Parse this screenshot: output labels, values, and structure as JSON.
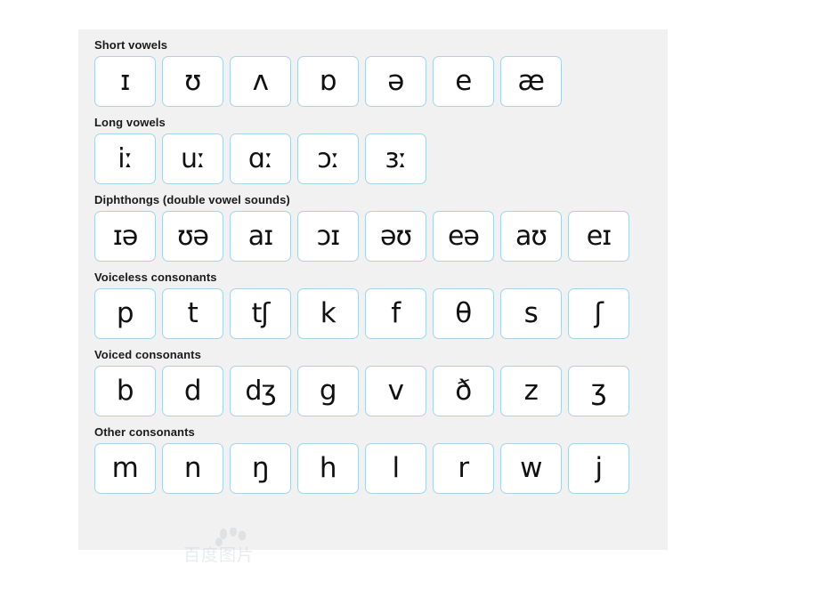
{
  "panel": {
    "background_color": "#f1f1f1",
    "tile_border_color": "#a8d4e5",
    "tile_background_color": "#ffffff",
    "text_color": "#111111"
  },
  "watermark": {
    "text": "百度图片",
    "mark": "watermark-logo"
  },
  "sections": [
    {
      "heading": "Short vowels",
      "symbols": [
        "ɪ",
        "ʊ",
        "ʌ",
        "ɒ",
        "ə",
        "e",
        "æ"
      ]
    },
    {
      "heading": "Long vowels",
      "symbols": [
        "iː",
        "uː",
        "ɑː",
        "ɔː",
        "ɜː"
      ]
    },
    {
      "heading": "Diphthongs (double vowel sounds)",
      "symbols": [
        "ɪə",
        "ʊə",
        "aɪ",
        "ɔɪ",
        "əʊ",
        "eə",
        "aʊ",
        "eɪ"
      ]
    },
    {
      "heading": "Voiceless consonants",
      "symbols": [
        "p",
        "t",
        "tʃ",
        "k",
        "f",
        "θ",
        "s",
        "ʃ"
      ]
    },
    {
      "heading": "Voiced consonants",
      "symbols": [
        "b",
        "d",
        "dʒ",
        "g",
        "v",
        "ð",
        "z",
        "ʒ"
      ]
    },
    {
      "heading": "Other consonants",
      "symbols": [
        "m",
        "n",
        "ŋ",
        "h",
        "l",
        "r",
        "w",
        "j"
      ]
    }
  ]
}
